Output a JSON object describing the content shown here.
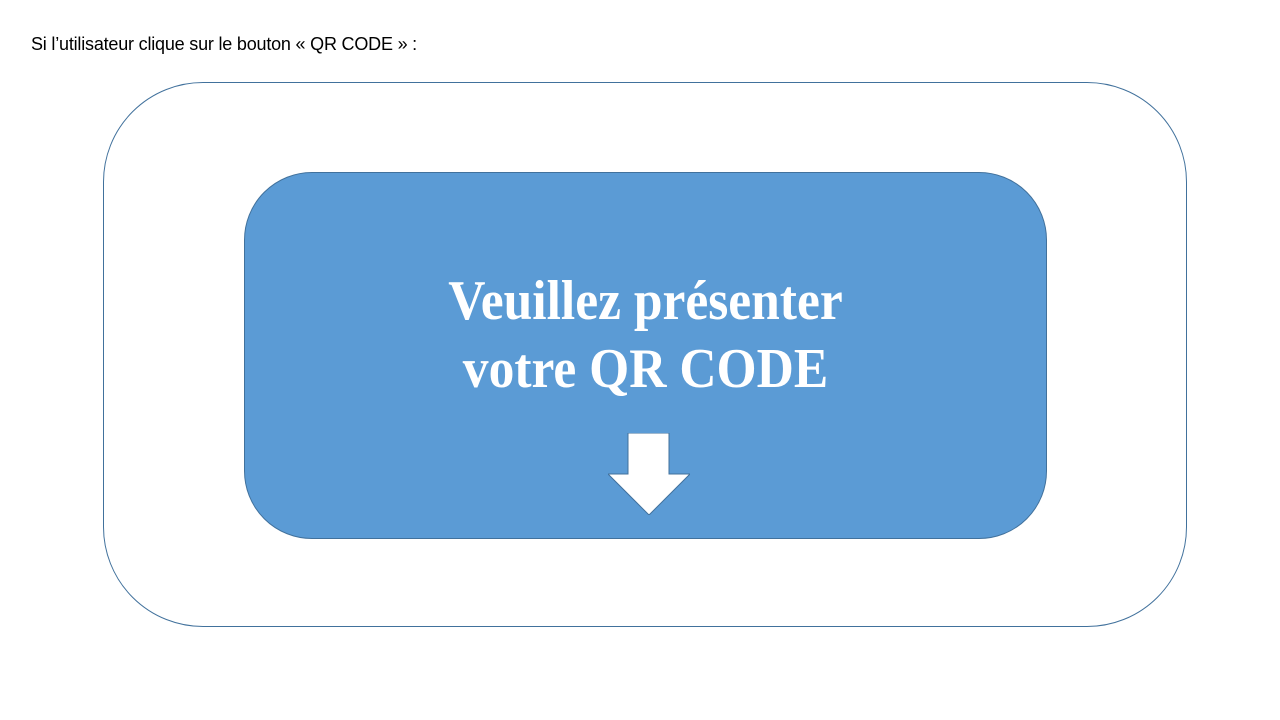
{
  "caption": "Si l’utilisateur clique sur le bouton « QR CODE » :",
  "panel": {
    "line1": "Veuillez présenter",
    "line2": "votre QR CODE",
    "icon": "arrow-down-icon"
  },
  "colors": {
    "panel_fill": "#5b9bd5",
    "outline": "#41719c",
    "panel_text": "#ffffff"
  }
}
